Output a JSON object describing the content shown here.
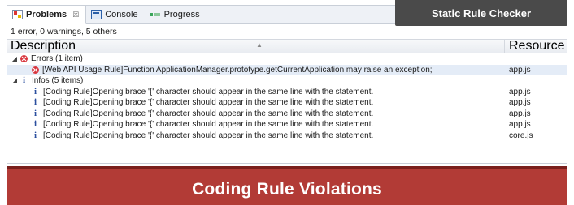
{
  "tabs": [
    {
      "label": "Problems",
      "close": "☒",
      "icon": "problems-icon"
    },
    {
      "label": "Console",
      "icon": "console-icon"
    },
    {
      "label": "Progress",
      "icon": "progress-icon"
    }
  ],
  "badge": {
    "text": "Static Rule Checker"
  },
  "summary": "1 error, 0 warnings, 5 others",
  "columns": {
    "description": "Description",
    "resource": "Resource"
  },
  "groups": {
    "errors": {
      "label": "Errors (1 item)",
      "items": [
        {
          "description": "[Web API Usage Rule]Function ApplicationManager.prototype.getCurrentApplication may raise an exception;",
          "resource": "app.js"
        }
      ]
    },
    "infos": {
      "label": "Infos (5 items)",
      "items": [
        {
          "description": "[Coding Rule]Opening brace '{' character should appear in the same line with the statement.",
          "resource": "app.js"
        },
        {
          "description": "[Coding Rule]Opening brace '{' character should appear in the same line with the statement.",
          "resource": "app.js"
        },
        {
          "description": "[Coding Rule]Opening brace '{' character should appear in the same line with the statement.",
          "resource": "app.js"
        },
        {
          "description": "[Coding Rule]Opening brace '{' character should appear in the same line with the statement.",
          "resource": "app.js"
        },
        {
          "description": "[Coding Rule]Opening brace '{' character should appear in the same line with the statement.",
          "resource": "core.js"
        }
      ]
    }
  },
  "footer": {
    "text": "Coding Rule Violations"
  },
  "colors": {
    "footer_bg": "#b23b36",
    "badge_bg": "#4a4a4a",
    "error": "#d9363e",
    "info": "#2b4f9e"
  }
}
